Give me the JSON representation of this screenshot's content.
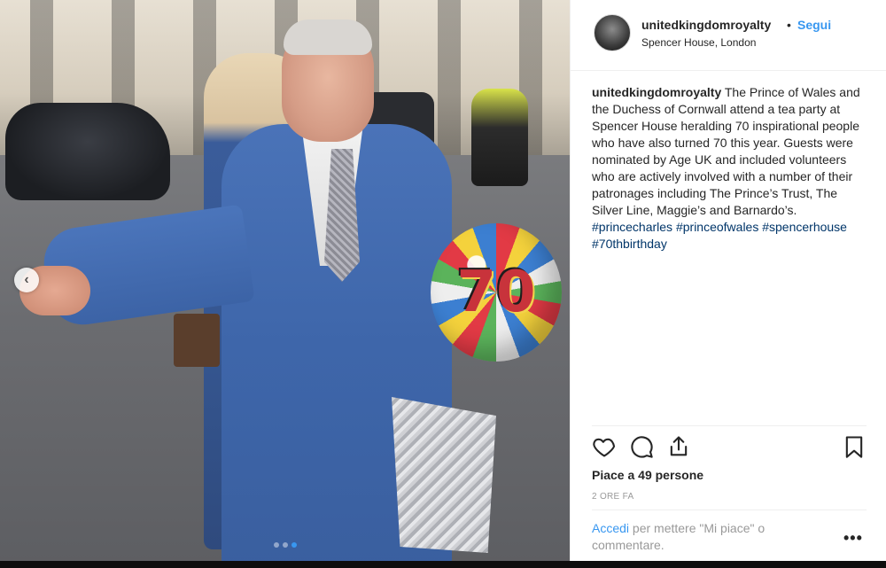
{
  "post": {
    "username": "unitedkingdomroyalty",
    "follow_label": "Segui",
    "location": "Spencer House, London",
    "caption_user": "unitedkingdomroyalty",
    "caption_text": "The Prince of Wales and the Duchess of Cornwall attend a tea party at Spencer House heralding 70 inspirational people who have also turned 70 this year. Guests were nominated by Age UK and included volunteers who are actively involved with a number of their patronages including The Prince’s Trust, The Silver Line, Maggie’s and Barnardo’s.",
    "hashtags": [
      "#princecharles",
      "#princeofwales",
      "#spencerhouse",
      "#70thbirthday"
    ],
    "likes": "Piace a 49 persone",
    "time_ago": "2 ORE FA",
    "footer_login": "Accedi",
    "footer_rest": "per mettere \"Mi piace\" o commentare.",
    "more_label": "•••"
  },
  "photo": {
    "balloon_text": "70",
    "carousel_total": 3,
    "carousel_active": 3
  },
  "icons": [
    "heart-icon",
    "comment-icon",
    "share-icon",
    "bookmark-icon",
    "chevron-left-icon"
  ],
  "colors": {
    "accent": "#3897f0",
    "hashtag": "#003569",
    "text": "#262626",
    "muted": "#999999"
  }
}
